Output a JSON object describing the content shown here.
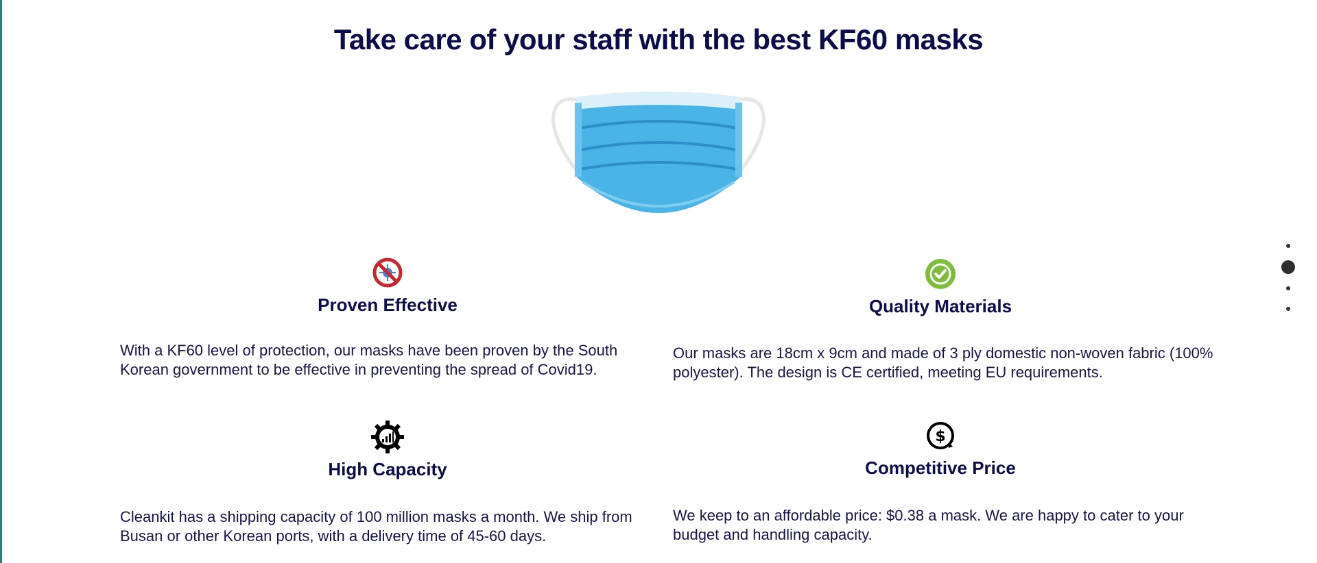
{
  "page": {
    "title": "Take care of your staff with the best KF60 masks"
  },
  "features": [
    {
      "heading": "Proven Effective",
      "body": "With a KF60 level of protection, our masks have been proven by the South Korean government to be effective in preventing the spread of Covid19.",
      "icon": "no-virus-icon"
    },
    {
      "heading": "Quality Materials",
      "body": "Our masks are 18cm x 9cm and made of 3 ply domestic non-woven fabric (100% polyester). The design is CE certified, meeting EU requirements.",
      "icon": "check-badge-icon"
    },
    {
      "heading": "High Capacity",
      "body": "Cleankit has a shipping capacity of 100 million masks a month. We ship from Busan or other Korean ports, with a delivery time of 45-60 days.",
      "icon": "gear-chart-icon"
    },
    {
      "heading": "Competitive Price",
      "body": "We keep to an affordable price: $0.38 a mask. We are happy to cater to your budget and handling capacity.",
      "icon": "dollar-refresh-icon"
    }
  ],
  "pagination": {
    "count": 4,
    "active_index": 1
  },
  "colors": {
    "heading": "#0c0c4a",
    "text": "#15154a",
    "mask_blue": "#4ab4e6",
    "no_icon_red": "#c8282d",
    "check_green": "#7ebd3a",
    "edge_teal": "#2e7f74"
  }
}
